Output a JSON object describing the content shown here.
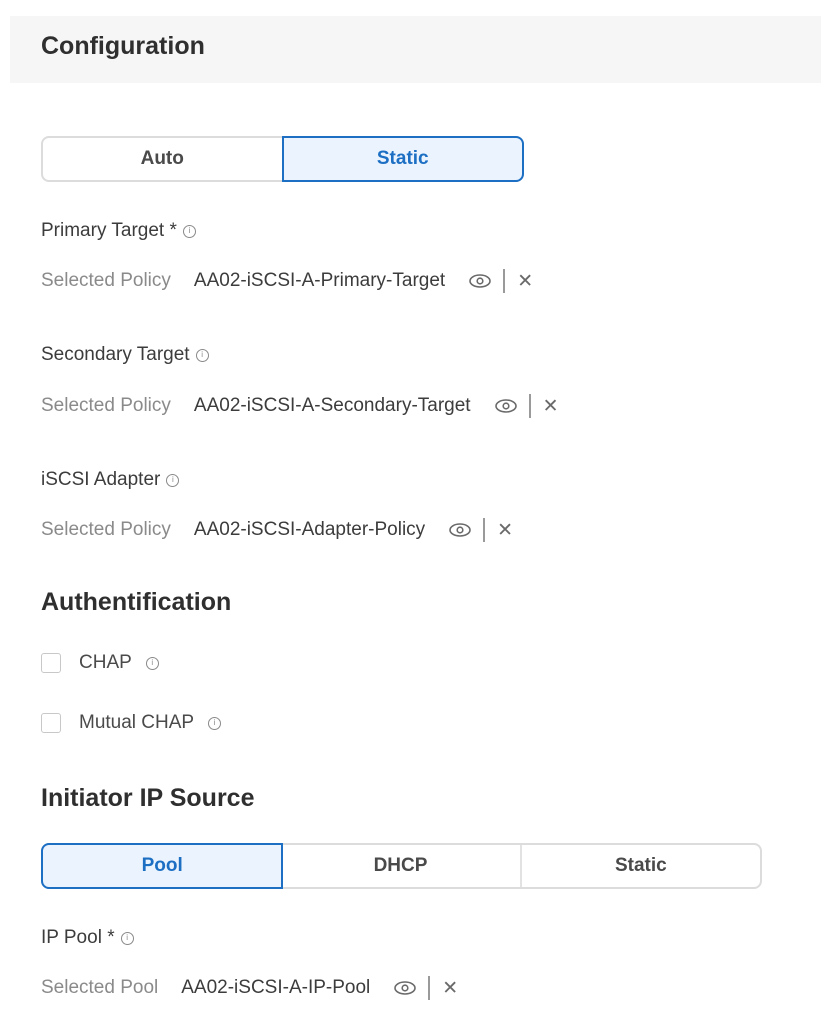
{
  "header": {
    "title": "Configuration"
  },
  "mode_toggle": {
    "options": [
      {
        "label": "Auto",
        "active": false
      },
      {
        "label": "Static",
        "active": true
      }
    ]
  },
  "primary_target": {
    "label": "Primary Target *",
    "key": "Selected Policy",
    "value": "AA02-iSCSI-A-Primary-Target"
  },
  "secondary_target": {
    "label": "Secondary Target",
    "key": "Selected Policy",
    "value": "AA02-iSCSI-A-Secondary-Target"
  },
  "iscsi_adapter": {
    "label": "iSCSI Adapter",
    "key": "Selected Policy",
    "value": "AA02-iSCSI-Adapter-Policy"
  },
  "authentication": {
    "title": "Authentification",
    "options": [
      {
        "label": "CHAP",
        "checked": false
      },
      {
        "label": "Mutual CHAP",
        "checked": false
      }
    ]
  },
  "initiator_ip_source": {
    "title": "Initiator IP Source",
    "options": [
      {
        "label": "Pool",
        "active": true
      },
      {
        "label": "DHCP",
        "active": false
      },
      {
        "label": "Static",
        "active": false
      }
    ]
  },
  "ip_pool": {
    "label": "IP Pool *",
    "key": "Selected Pool",
    "value": "AA02-iSCSI-A-IP-Pool"
  },
  "colors": {
    "accent": "#1d6fc4",
    "accent_bg": "#eaf3fe",
    "header_bg": "#f6f6f6"
  }
}
